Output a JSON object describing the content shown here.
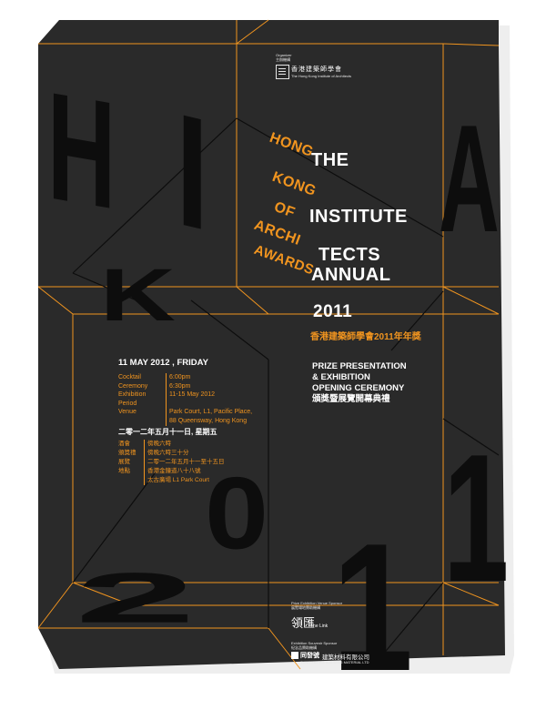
{
  "colors": {
    "poster_bg": "#2a2a2a",
    "accent": "#f0941f",
    "letters": "#0d0d0d",
    "text_white": "#ffffff"
  },
  "organizer": {
    "label": "Organizer",
    "label_zh": "主辦機構",
    "name_zh": "香港建築師學會",
    "name_en": "The Hong Kong Institute of Architects"
  },
  "title": {
    "word_the": "THE",
    "word_hong": "HONG",
    "word_kong": "KONG",
    "word_institute": "INSTITUTE",
    "word_of": "OF",
    "word_architects_a": "ARCHI",
    "word_architects_b": "TECTS",
    "word_awards": "AWARDS",
    "word_annual": "ANNUAL",
    "year": "2011",
    "chinese": "香港建築師學會2011年年獎"
  },
  "big_letters": {
    "h": "H",
    "i": "I",
    "a": "A",
    "k": "K",
    "two": "2",
    "zero": "0",
    "one_a": "1",
    "one_b": "1"
  },
  "event": {
    "date": "11 MAY 2012 , FRIDAY",
    "rows": [
      {
        "label": "Cocktail",
        "value": "6:00pm"
      },
      {
        "label": "Ceremony",
        "value": "6:30pm"
      },
      {
        "label": "Exhibition Period",
        "value": "11-15 May 2012"
      },
      {
        "label": "Venue",
        "value": "Park Court, L1, Pacific Place,"
      },
      {
        "label": "",
        "value": "88 Queensway, Hong Kong"
      }
    ],
    "date_zh": "二零一二年五月十一日, 星期五",
    "rows_zh": [
      {
        "label": "酒會",
        "value": "傍晚六時"
      },
      {
        "label": "頒獎禮",
        "value": "傍晚六時三十分"
      },
      {
        "label": "展覽",
        "value": "二零一二年五月十一至十五日"
      },
      {
        "label": "地點",
        "value": "香港金鐘道八十八號"
      },
      {
        "label": "",
        "value": "太古廣場 L1 Park Court"
      }
    ]
  },
  "prize": {
    "line1": "PRIZE PRESENTATION",
    "line2": "& EXHIBITION",
    "line3": "OPENING CEREMONY",
    "chinese": "頒獎暨展覽開幕典禮"
  },
  "sponsors": {
    "venue_label": "Prize Exhibition Venue Sponsor",
    "venue_label_zh": "展覽場地贊助機構",
    "venue_name_zh": "領匯",
    "venue_name_en": "The Link",
    "souvenir_label": "Exhibition Souvenir Sponsor",
    "souvenir_label_zh": "紀念品贊助機構",
    "company_zh": "同發號",
    "company_zh_tail": "建築材料有限公司",
    "company_en": "TUNG FAT HO BUILDING MATERIAL LTD"
  }
}
